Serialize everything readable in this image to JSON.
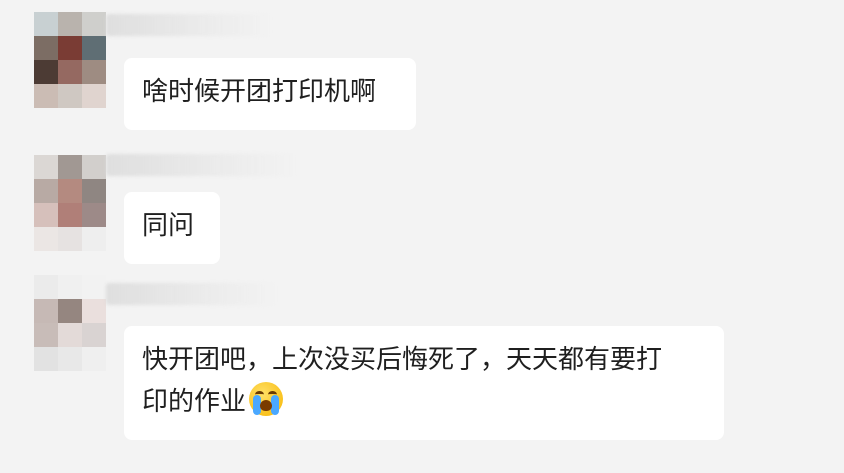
{
  "chat": {
    "background_color": "#f3f3f3",
    "bubble_color": "#ffffff",
    "messages": [
      {
        "text": "啥时候开团打印机啊",
        "avatar_colors": [
          "#c8d0d2",
          "#b9b3ad",
          "#cfcfcc",
          "#7c6d64",
          "#7a3c34",
          "#5f6e74",
          "#4c3b34",
          "#956961",
          "#9e8c82",
          "#cbbcb4",
          "#cfc8c2",
          "#e0d4cf"
        ]
      },
      {
        "text": "同问",
        "avatar_colors": [
          "#dbd7d4",
          "#a19893",
          "#d2cfcc",
          "#b8aaa4",
          "#b48a80",
          "#8f8682",
          "#d6c0bb",
          "#b07f78",
          "#9d8a88",
          "#ebe6e4",
          "#e6e2e1",
          "#eeeeee"
        ]
      },
      {
        "text": "快开团吧，上次没买后悔死了，天天都有要打\n印的作业",
        "emoji": "loudly-crying-face",
        "avatar_colors": [
          "#ebebeb",
          "#f0f0f0",
          "#f2f2f2",
          "#c6b9b5",
          "#958680",
          "#eadfdd",
          "#c8bcb8",
          "#e3dad8",
          "#d9d3d2",
          "#e2e2e2",
          "#e8e8e8",
          "#efefef"
        ]
      }
    ]
  }
}
